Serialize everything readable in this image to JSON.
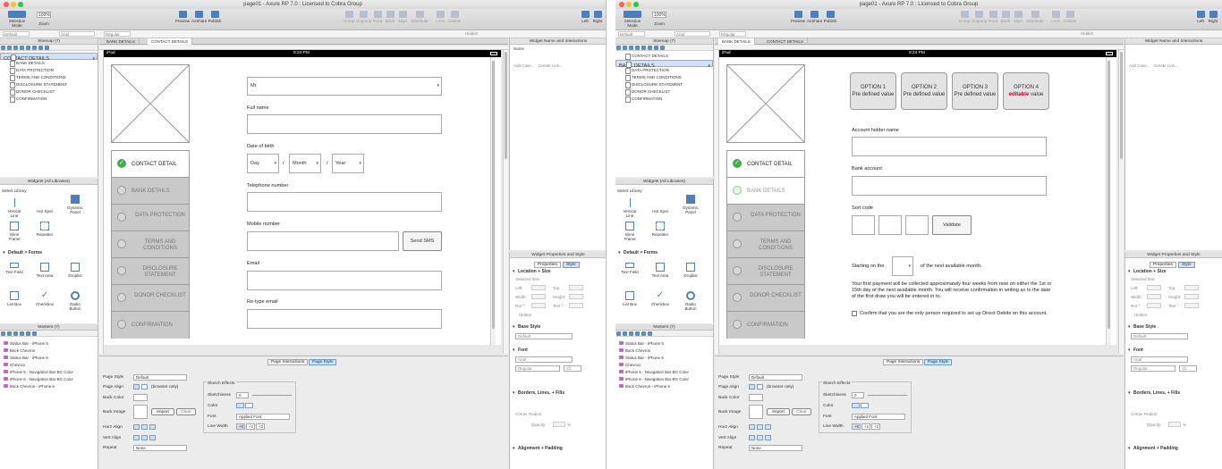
{
  "title": "page01 - Axure RP 7.0 : Licensed to Cobra Group",
  "toolbar": {
    "selection_mode": "Selection Mode",
    "zoom_label": "Zoom",
    "zoom_value": "100%",
    "preview": "Preview",
    "axshare": "AxShare",
    "publish": "Publish",
    "group": "Group",
    "ungroup": "Ungroup",
    "front": "Front",
    "back": "Back",
    "align": "Align",
    "distribute": "Distribute",
    "lock": "Lock",
    "unlock": "Unlock",
    "left": "Left",
    "right": "Right"
  },
  "format_bar": {
    "style": "Default",
    "font": "Arial",
    "weight": "Regular",
    "hidden": "Hidden"
  },
  "sitemap": {
    "title": "Sitemap (7)",
    "pages": [
      "CONTACT DETAILS",
      "BANK DETAILS",
      "DATA PROTECTION",
      "TERMS AND CONDITIONS",
      "DISCLOSURE STATEMENT",
      "DONOR CHECKLIST",
      "CONFIRMATION"
    ]
  },
  "widgets": {
    "title": "Widgets (All Libraries)",
    "select_library": "Select Library",
    "row1": [
      "Vertical Line",
      "Hot Spot",
      "Dynamic Panel"
    ],
    "row2": [
      "Inline Frame",
      "Repeater"
    ],
    "forms_title": "Default > Forms",
    "forms_row1": [
      "Text Field",
      "Text Area",
      "Droplist"
    ],
    "forms_row2": [
      "List Box",
      "Checkbox",
      "Radio Button"
    ]
  },
  "masters": {
    "title": "Masters (7)",
    "items": [
      "Status Bar - iPhone 5",
      "Back Chevron",
      "Status Bar - iPhone 6",
      "Chevron",
      "iPhone 5 - Navigation Bar BG Color",
      "iPhone 6 - Navigation Bar BG Color",
      "Back Chevron - iPhone 6"
    ]
  },
  "bottom": {
    "tab_interactions": "Page Interactions",
    "tab_style": "Page Style",
    "page_style_label": "Page Style",
    "page_style_value": "Default",
    "page_align": "Page Align",
    "browser_only": "(browser only)",
    "back_color": "Back Color",
    "back_image": "Back Image",
    "import": "Import",
    "clear": "Clear",
    "horz_align": "Horz Align",
    "vert_align": "Vert Align",
    "repeat": "Repeat",
    "repeat_value": "None",
    "sketch_effects": "Sketch Effects",
    "sketchiness": "Sketchiness",
    "sketch_value": "0",
    "color": "Color",
    "font": "Font",
    "font_value": "Applied Font",
    "line_width": "Line Width",
    "lw": [
      "+0",
      "+1",
      "+2"
    ]
  },
  "right": {
    "name_panel": "Widget Name and Interactions",
    "name": "Name",
    "add_case": "Add Case...",
    "create_link": "Create Link...",
    "props_panel": "Widget Properties and Style",
    "tab_props": "Properties",
    "tab_style": "Style",
    "location_size": "Location + Size",
    "selected_item": "Selected Item",
    "left": "Left:",
    "top": "Top:",
    "width": "Width:",
    "height": "Height:",
    "rot": "Rot °:",
    "text": "Text °:",
    "hidden": "Hidden",
    "base_style": "Base Style",
    "base_default": "Default",
    "font": "Font",
    "font_value": "Arial",
    "font_weight": "Regular",
    "font_size": "13",
    "borders": "Borders, Lines, + Fills",
    "corner_radius": "Corner Radius:",
    "opacity": "Opacity:",
    "percent": "%",
    "alignment": "Alignment + Padding"
  },
  "left_window": {
    "tabs": [
      "BANK DETAILS",
      "CONTACT DETAILS"
    ],
    "time": "9:24 PM",
    "ipad": "iPad",
    "nav": [
      "CONTACT DETAIL",
      "BANK DETAILS",
      "DATA PROTECTION",
      "TERMS AND CONDITIONS",
      "DISCLOSURE STATEMENT",
      "DONOR CHECKLIST",
      "CONFIRMATION"
    ],
    "form": {
      "title_value": "Mr",
      "full_name": "Full name",
      "dob": "Date of birth",
      "day": "Day",
      "month": "Month",
      "year": "Year",
      "slash": "/",
      "telephone": "Telephone number",
      "mobile": "Mobile number",
      "send_sms": "Send SMS",
      "email": "Email",
      "retype_email": "Re-type email"
    }
  },
  "right_window": {
    "tabs": [
      "BANK DETAILS",
      "CONTACT DETAILS"
    ],
    "time": "9:24 PM",
    "ipad": "iPad",
    "nav": [
      "CONTACT DETAIL",
      "BANK DETAILS",
      "DATA PROTECTION",
      "TERMS AND CONDITIONS",
      "DISCLOSURE STATEMENT",
      "DONOR CHECKLIST",
      "CONFIRMATION"
    ],
    "options": [
      {
        "t": "OPTION 1",
        "s": "Pre defined value"
      },
      {
        "t": "OPTION 2",
        "s": "Pre defined value"
      },
      {
        "t": "OPTION 3",
        "s": "Pre defined value"
      },
      {
        "t": "OPTION 4",
        "e": "editable",
        "s": "value"
      }
    ],
    "form": {
      "account_holder": "Account holder name",
      "bank_account": "Bank account",
      "sort_code": "Sort code",
      "validate": "Validate",
      "starting_on": "Starting on the",
      "next_month": "of the next available month.",
      "notice": "Your first payment will be collected approximately four weeks from now on either the 1st or 15th day of the next available month. You will receive confirmation in writing as to the date of the first draw you will be entered in to.",
      "confirm": "Confirm that you are the only person required to set up Direct Debits on this account."
    }
  },
  "colors": {
    "accent": "#4f7fb8",
    "check_green": "#3fae49",
    "nav_gray": "#c9c9c9",
    "editable_red": "#d0021b"
  }
}
